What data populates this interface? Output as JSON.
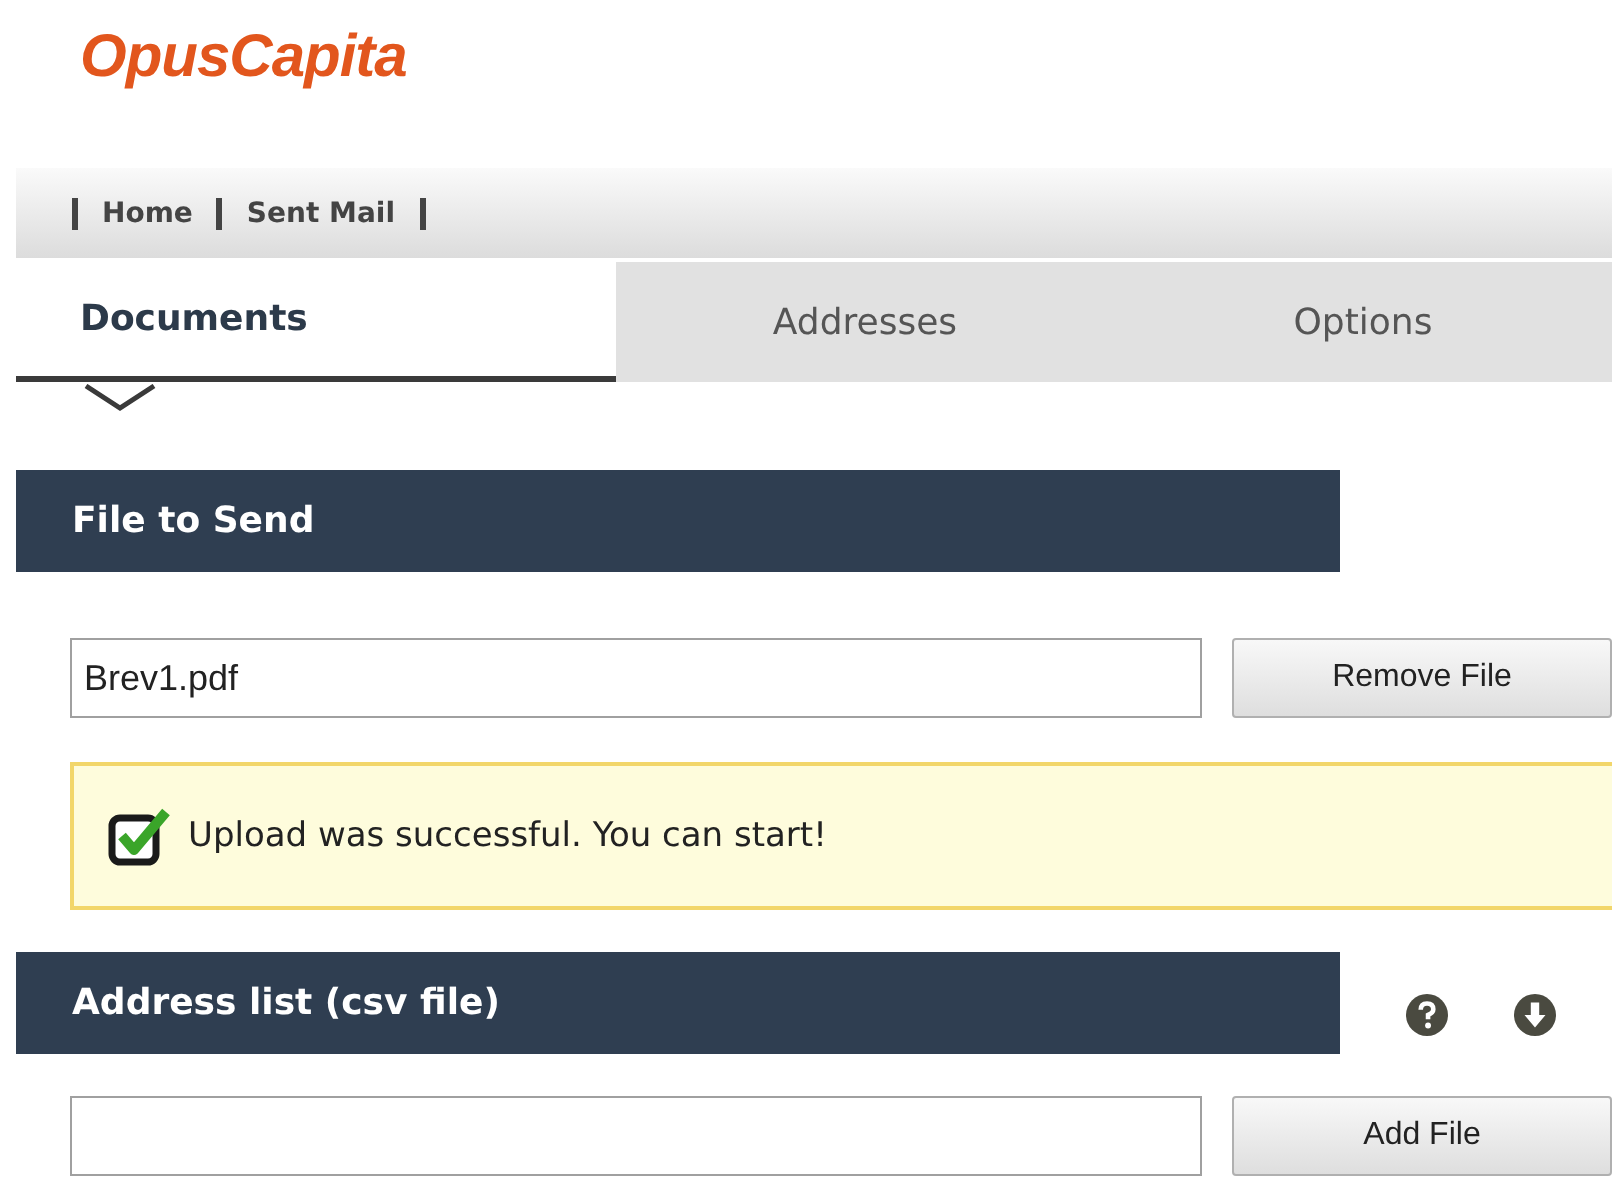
{
  "logo": "OpusCapita",
  "nav": [
    {
      "label": "Home"
    },
    {
      "label": "Sent Mail"
    }
  ],
  "tabs": [
    {
      "label": "Documents",
      "selected": true
    },
    {
      "label": "Addresses",
      "selected": false
    },
    {
      "label": "Options",
      "selected": false
    }
  ],
  "file_section": {
    "title": "File to Send",
    "field": {
      "value": "Brev1.pdf"
    },
    "button": "Remove File"
  },
  "alert": {
    "text": "Upload was successful. You can start!",
    "checked": true
  },
  "address_section": {
    "title": "Address list (csv file)",
    "button": "Add File"
  }
}
